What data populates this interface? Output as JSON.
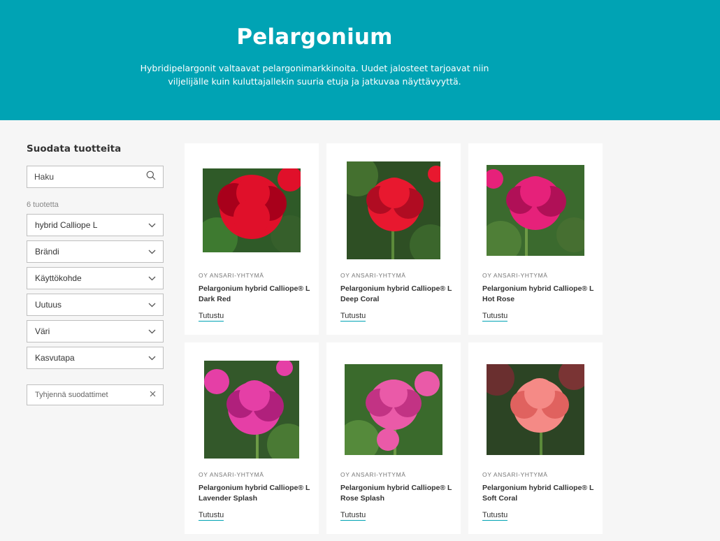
{
  "hero": {
    "title": "Pelargonium",
    "description": "Hybridipelargonit valtaavat pelargonimarkkinoita. Uudet jalosteet tarjoavat niin viljelijälle kuin kuluttajallekin suuria etuja ja jatkuvaa näyttävyyttä."
  },
  "colors": {
    "accent": "#00a3b4",
    "background": "#f6f6f6",
    "card": "#ffffff"
  },
  "sidebar": {
    "title": "Suodata tuotteita",
    "search_placeholder": "Haku",
    "search_icon": "search-icon",
    "count": "6 tuotetta",
    "filters": [
      {
        "label": "hybrid Calliope L"
      },
      {
        "label": "Brändi"
      },
      {
        "label": "Käyttökohde"
      },
      {
        "label": "Uutuus"
      },
      {
        "label": "Väri"
      },
      {
        "label": "Kasvutapa"
      }
    ],
    "clear_label": "Tyhjennä suodattimet"
  },
  "products": [
    {
      "brand": "OY ANSARI-YHTYMÄ",
      "name": "Pelargonium hybrid Calliope® L Dark Red",
      "link": "Tutustu",
      "flower_color": "#e0102a",
      "flower_shade": "#a8001b"
    },
    {
      "brand": "OY ANSARI-YHTYMÄ",
      "name": "Pelargonium hybrid Calliope® L Deep Coral",
      "link": "Tutustu",
      "flower_color": "#e8182f",
      "flower_shade": "#b00c22"
    },
    {
      "brand": "OY ANSARI-YHTYMÄ",
      "name": "Pelargonium hybrid Calliope® L Hot Rose",
      "link": "Tutustu",
      "flower_color": "#e6217a",
      "flower_shade": "#b01057"
    },
    {
      "brand": "OY ANSARI-YHTYMÄ",
      "name": "Pelargonium hybrid Calliope® L Lavender Splash",
      "link": "Tutustu",
      "flower_color": "#e53fa6",
      "flower_shade": "#b0207c"
    },
    {
      "brand": "OY ANSARI-YHTYMÄ",
      "name": "Pelargonium hybrid Calliope® L Rose Splash",
      "link": "Tutustu",
      "flower_color": "#ea5aa8",
      "flower_shade": "#c23384"
    },
    {
      "brand": "OY ANSARI-YHTYMÄ",
      "name": "Pelargonium hybrid Calliope® L Soft Coral",
      "link": "Tutustu",
      "flower_color": "#f58a86",
      "flower_shade": "#e0625f"
    }
  ]
}
